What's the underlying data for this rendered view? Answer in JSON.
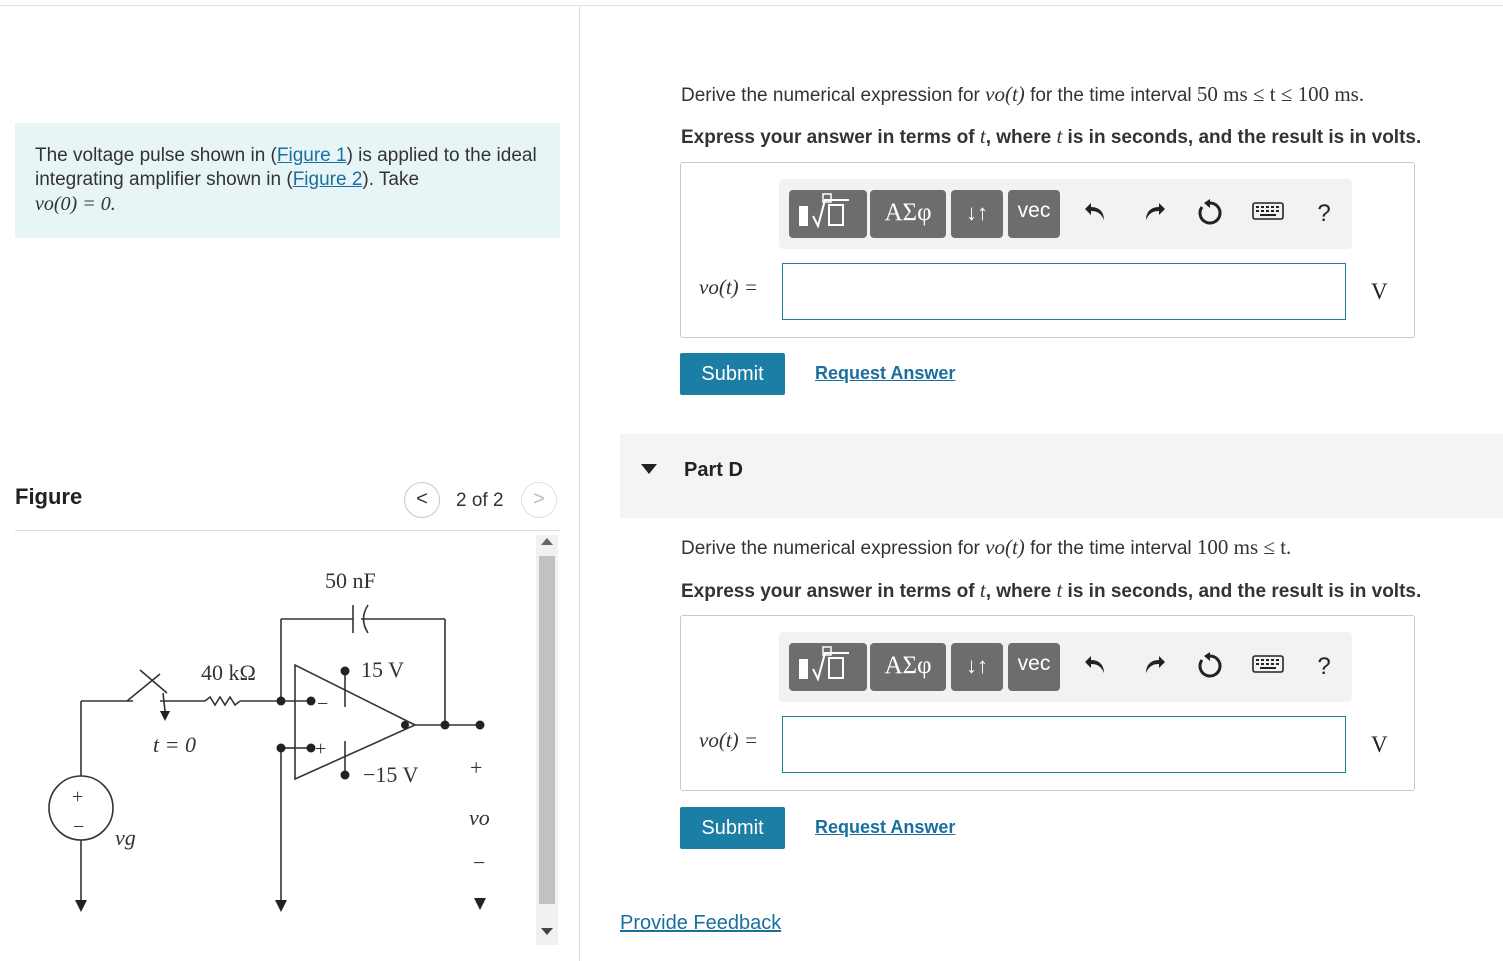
{
  "problem": {
    "text_before_fig1": "The voltage pulse shown in (",
    "fig1_link": "Figure 1",
    "text_between": ") is applied to the ideal integrating amplifier shown in (",
    "fig2_link": "Figure 2",
    "text_after": "). Take",
    "initial_condition": "vo(0) = 0."
  },
  "figure_panel": {
    "title": "Figure",
    "prev_label": "<",
    "next_label": ">",
    "count": "2 of 2",
    "circuit": {
      "capacitor": "50 nF",
      "resistor": "40 kΩ",
      "supply_pos": "15 V",
      "supply_neg": "−15 V",
      "switch_time": "t = 0",
      "source": "vg",
      "output": "vo",
      "plus": "+",
      "minus": "−"
    }
  },
  "part_c": {
    "question_prefix": "Derive the numerical expression for ",
    "question_var": "vo(t)",
    "question_mid": " for the time interval ",
    "question_interval": "50 ms ≤ t ≤ 100 ms.",
    "instruction_prefix": "Express your answer in terms of ",
    "instruction_var1": "t",
    "instruction_mid": ", where ",
    "instruction_var2": "t",
    "instruction_suffix": " is in seconds, and the result is in volts.",
    "answer_label": "vo(t) =",
    "answer_value": "",
    "unit": "V",
    "submit_label": "Submit",
    "request_label": "Request Answer"
  },
  "part_d": {
    "title": "Part D",
    "question_prefix": "Derive the numerical expression for ",
    "question_var": "vo(t)",
    "question_mid": " for the time interval ",
    "question_interval": "100 ms ≤ t.",
    "instruction_prefix": "Express your answer in terms of ",
    "instruction_var1": "t",
    "instruction_mid": ", where ",
    "instruction_var2": "t",
    "instruction_suffix": " is in seconds, and the result is in volts.",
    "answer_label": "vo(t) =",
    "answer_value": "",
    "unit": "V",
    "submit_label": "Submit",
    "request_label": "Request Answer"
  },
  "toolbar": {
    "greek_label": "ΑΣφ",
    "arrows_label": "↓↑",
    "vec_label": "vec",
    "help_label": "?",
    "icons": [
      "templates-icon",
      "undo-icon",
      "redo-icon",
      "reset-icon",
      "keyboard-icon",
      "help-icon"
    ]
  },
  "footer": {
    "feedback_label": "Provide Feedback"
  },
  "colors": {
    "accent": "#1c7ea5",
    "link": "#1a6f9e",
    "problem_bg": "#e8f5f7",
    "toolbar_button": "#6d6d6d"
  }
}
